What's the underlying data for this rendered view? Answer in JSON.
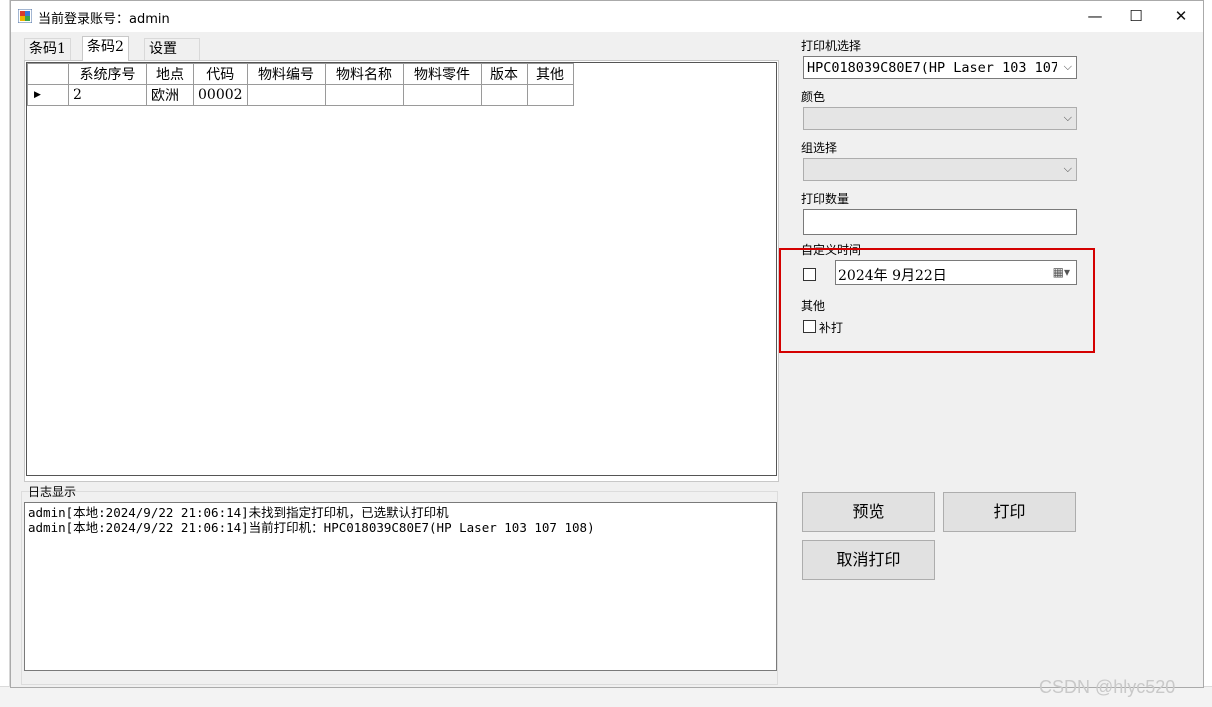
{
  "window": {
    "title": "当前登录账号：admin",
    "minimize": "—",
    "maximize": "☐",
    "close": "✕"
  },
  "tabs": [
    {
      "label": "条码1",
      "active": false
    },
    {
      "label": "条码2",
      "active": true
    },
    {
      "label": "设置",
      "active": false
    }
  ],
  "grid": {
    "columns": [
      "系统序号",
      "地点",
      "代码",
      "物料编号",
      "物料名称",
      "物料零件",
      "版本",
      "其他"
    ],
    "rows": [
      {
        "marker": "▶",
        "cells": [
          "2",
          "欧洲",
          "00002",
          "",
          "",
          "",
          "",
          ""
        ]
      }
    ]
  },
  "log": {
    "group_label": "日志显示",
    "lines": [
      "admin[本地:2024/9/22 21:06:14]未找到指定打印机，已选默认打印机",
      "admin[本地:2024/9/22 21:06:14]当前打印机：HPC018039C80E7(HP Laser 103 107 108)"
    ]
  },
  "right": {
    "printer_label": "打印机选择",
    "printer_value": "HPC018039C80E7(HP Laser 103 107",
    "color_label": "颜色",
    "color_value": "",
    "group_label": "组选择",
    "group_value": "",
    "qty_label": "打印数量",
    "qty_value": "",
    "custom_time_label": "自定义时间",
    "date_value": "2024年  9月22日",
    "other_label": "其他",
    "reprint_label": "补打",
    "preview_btn": "预览",
    "print_btn": "打印",
    "cancel_btn": "取消打印"
  },
  "watermark": "CSDN @hlyc520"
}
